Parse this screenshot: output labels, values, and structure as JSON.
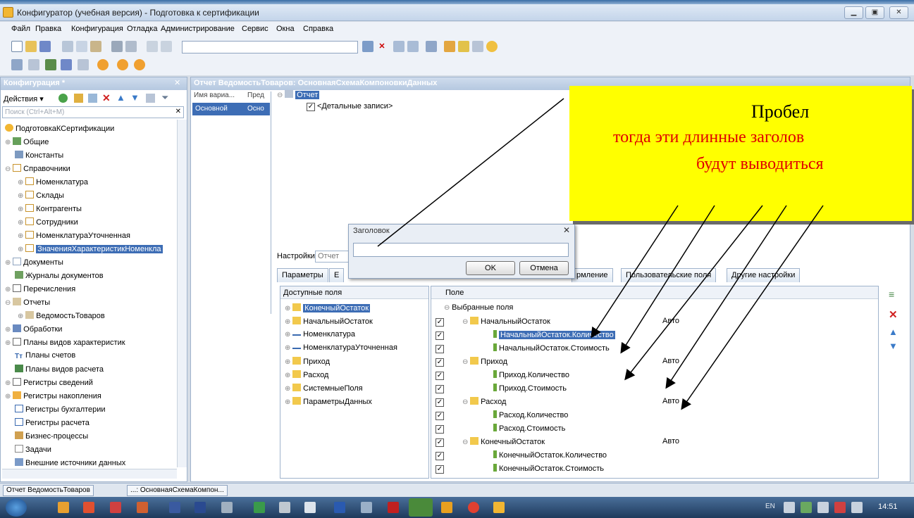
{
  "title": "Конфигуратор (учебная версия) - Подготовка к сертификации",
  "menu": [
    "Файл",
    "Правка",
    "Конфигурация",
    "Отладка",
    "Администрирование",
    "Сервис",
    "Окна",
    "Справка"
  ],
  "config_panel": {
    "title": "Конфигурация *",
    "actions": "Действия ▾",
    "search_placeholder": "Поиск (Ctrl+Alt+M)",
    "tree": [
      "ПодготовкаКСертификации",
      "Общие",
      "Константы",
      "Справочники",
      "Номенклатура",
      "Склады",
      "Контрагенты",
      "Сотрудники",
      "НоменклатураУточненная",
      "ЗначенияХарактеристикНоменкла",
      "Документы",
      "Журналы документов",
      "Перечисления",
      "Отчеты",
      "ВедомостьТоваров",
      "Обработки",
      "Планы видов характеристик",
      "Планы счетов",
      "Планы видов расчета",
      "Регистры сведений",
      "Регистры накопления",
      "Регистры бухгалтерии",
      "Регистры расчета",
      "Бизнес-процессы",
      "Задачи",
      "Внешние источники данных"
    ]
  },
  "report_window": {
    "title": "Отчет ВедомостьТоваров: ОсновнаяСхемаКомпоновкиДанных",
    "variant_col1": "Имя вариа...",
    "variant_col2": "Пред",
    "variant_name": "Основной",
    "variant_pres": "Осно",
    "struct_root": "Отчет",
    "struct_detail": "<Детальные записи>",
    "settings_label": "Настройки:",
    "settings_value": "Отчет"
  },
  "tabs": [
    "Параметры",
    "Е",
    "рмление",
    "Пользовательские поля",
    "Другие настройки"
  ],
  "available": {
    "header": "Доступные поля",
    "items": [
      "КонечныйОстаток",
      "НачальныйОстаток",
      "Номенклатура",
      "НоменклатураУточненная",
      "Приход",
      "Расход",
      "СистемныеПоля",
      "ПараметрыДанных"
    ]
  },
  "selected": {
    "header": "Поле",
    "root": "Выбранные поля",
    "auto": "Авто",
    "rows": [
      "НачальныйОстаток",
      "НачальныйОстаток.Количество",
      "НачальныйОстаток.Стоимость",
      "Приход",
      "Приход.Количество",
      "Приход.Стоимость",
      "Расход",
      "Расход.Количество",
      "Расход.Стоимость",
      "КонечныйОстаток",
      "КонечныйОстаток.Количество",
      "КонечныйОстаток.Стоимость"
    ]
  },
  "dialog": {
    "title": "Заголовок",
    "ok": "OK",
    "cancel": "Отмена",
    "value": ""
  },
  "callout": {
    "line1": "Пробел",
    "line2": "тогда эти длинные заголов",
    "line3": "будут выводиться"
  },
  "window_tabs": [
    "Отчет ВедомостьТоваров",
    "...: ОсновнаяСхемаКомпон..."
  ],
  "taskbar": {
    "lang": "EN",
    "time": "14:51"
  },
  "colors": {
    "callout_bg": "#ffff00",
    "callout_text": "#e00000",
    "selection": "#3d6db5"
  }
}
